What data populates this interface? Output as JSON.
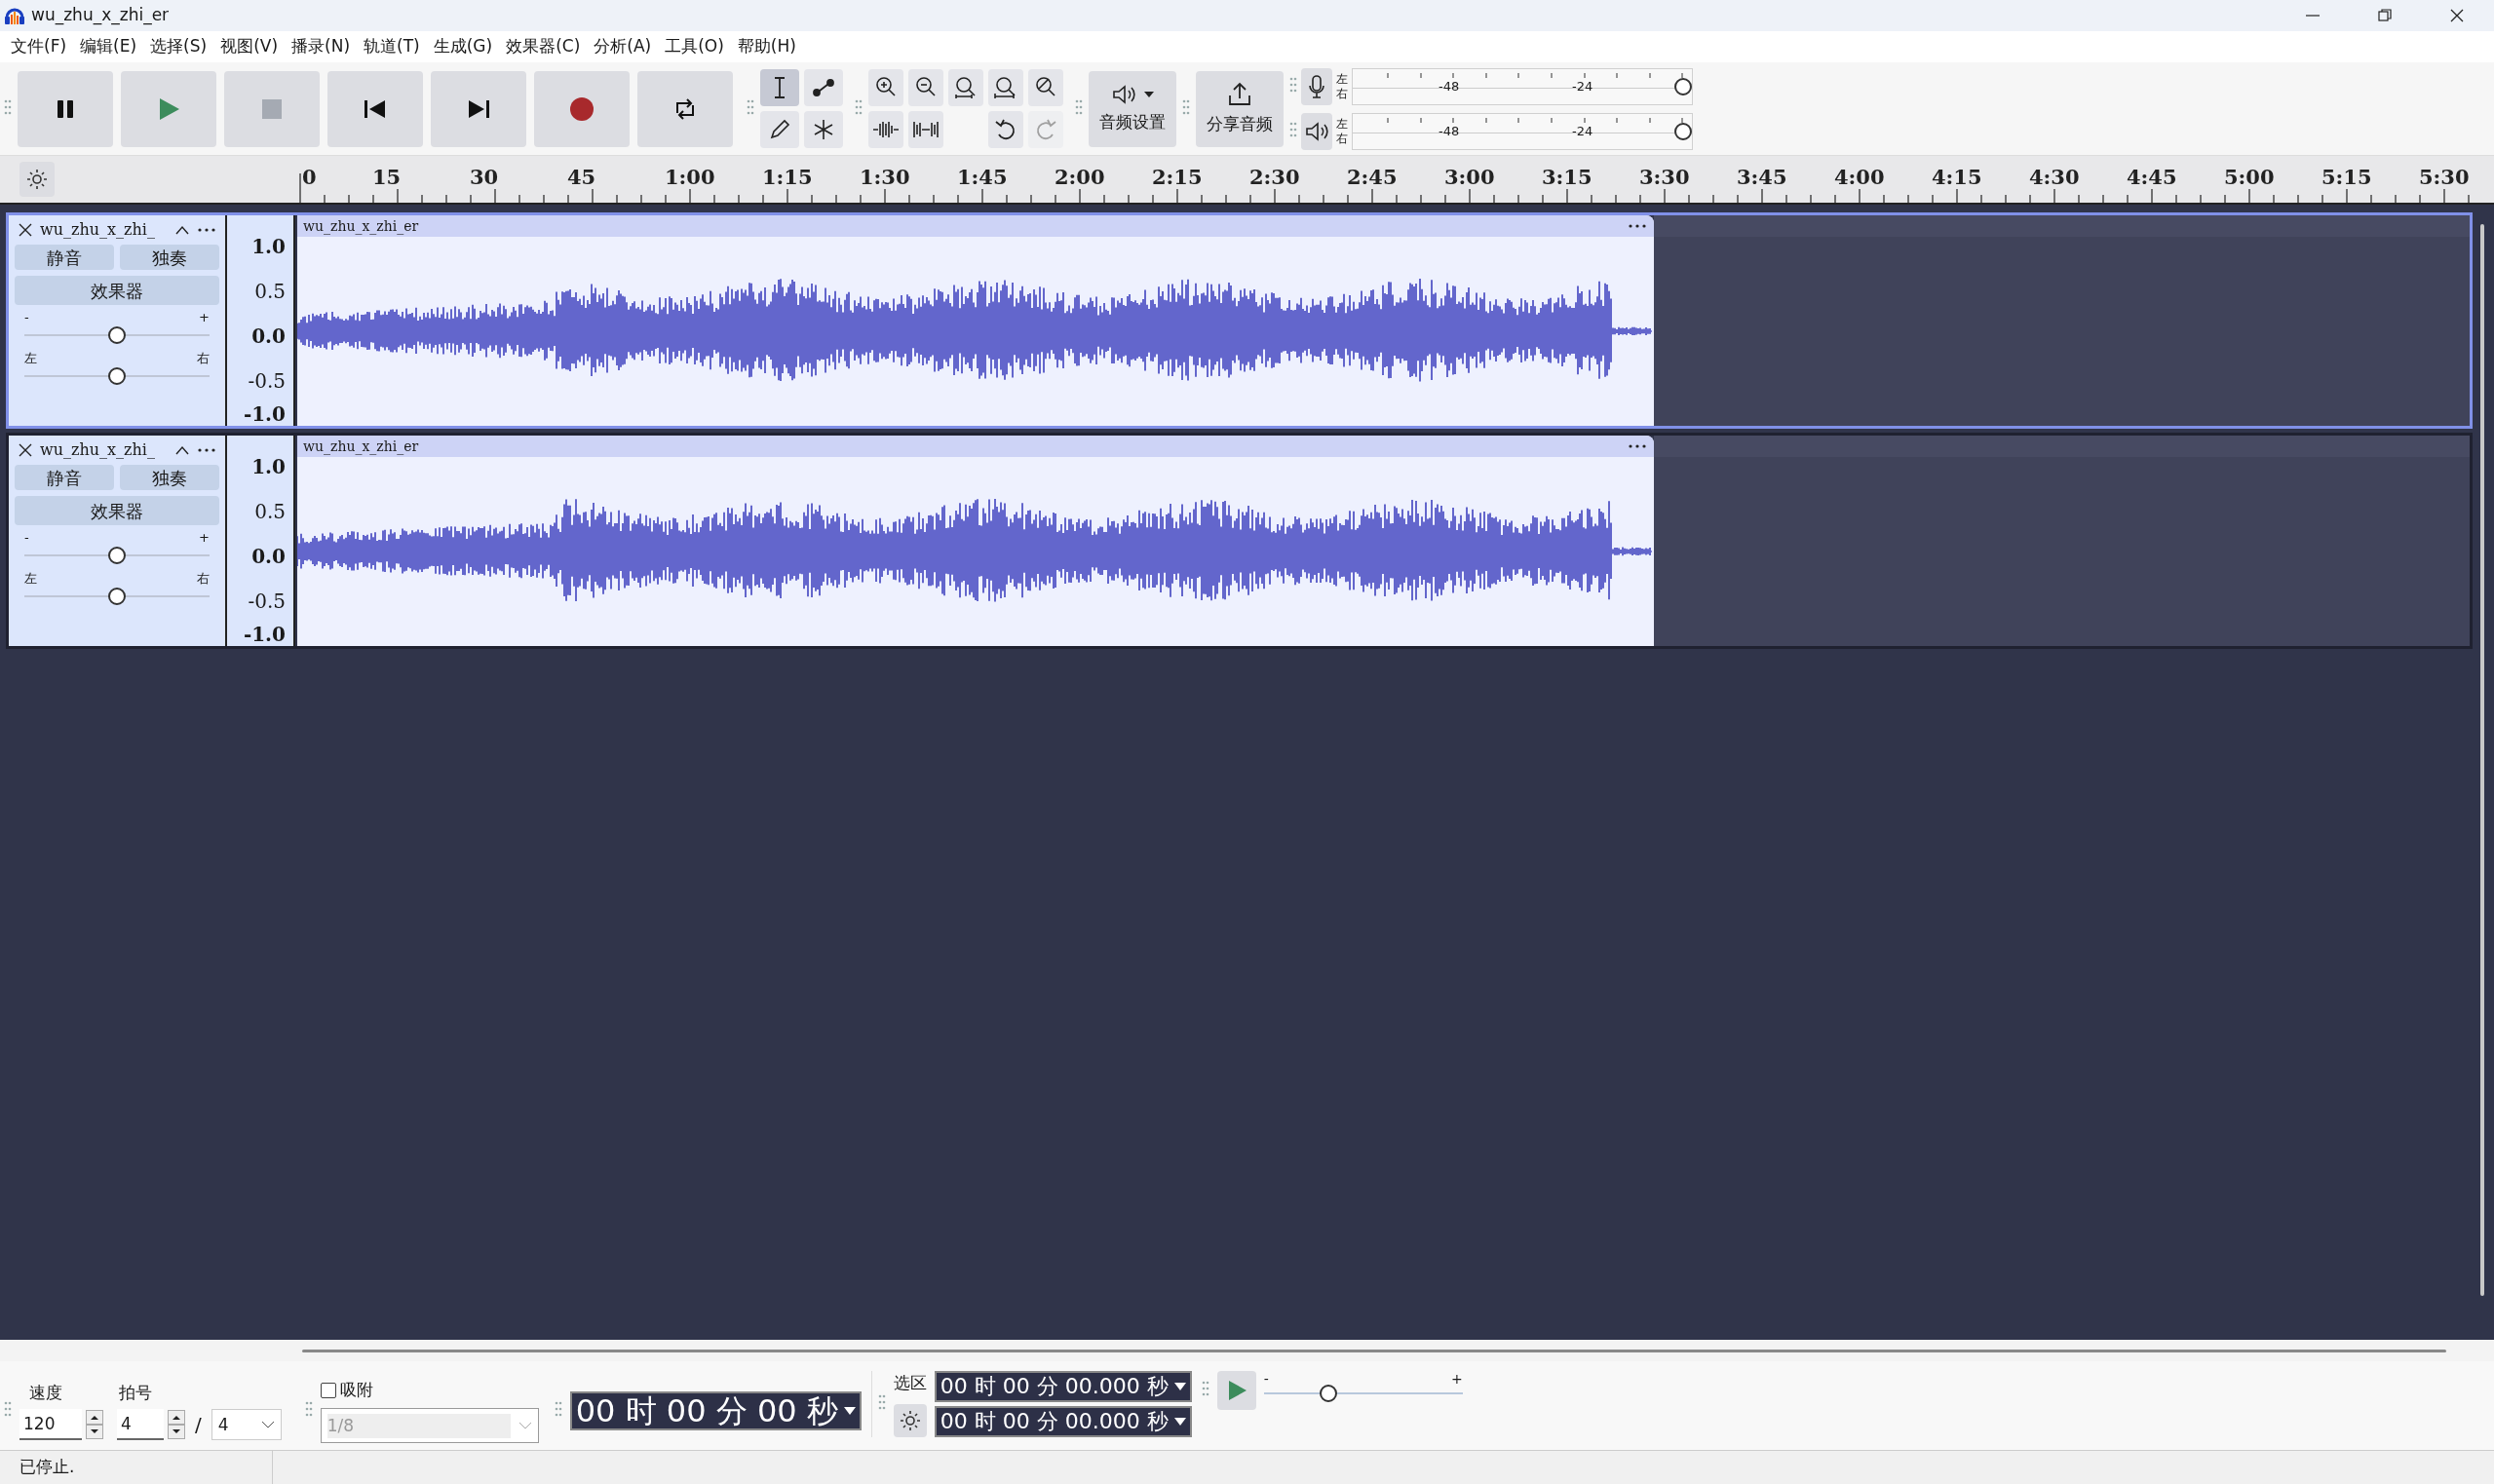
{
  "window": {
    "title": "wu_zhu_x_zhi_er"
  },
  "menu": [
    "文件(F)",
    "编辑(E)",
    "选择(S)",
    "视图(V)",
    "播录(N)",
    "轨道(T)",
    "生成(G)",
    "效果器(C)",
    "分析(A)",
    "工具(O)",
    "帮助(H)"
  ],
  "tools": [
    {
      "kind": "select",
      "selected": true
    },
    {
      "kind": "envelope",
      "selected": false
    },
    {
      "kind": "draw",
      "selected": false
    },
    {
      "kind": "multi",
      "selected": false
    }
  ],
  "edit_buttons": [
    {
      "kind": "zoom-in",
      "disabled": false
    },
    {
      "kind": "zoom-out",
      "disabled": false
    },
    {
      "kind": "fit-selection",
      "disabled": false
    },
    {
      "kind": "fit-project",
      "disabled": false
    },
    {
      "kind": "zoom-toggle",
      "disabled": false
    },
    {
      "kind": "trim",
      "disabled": false
    },
    {
      "kind": "silence",
      "disabled": false
    },
    {
      "kind": "undo",
      "disabled": false
    },
    {
      "kind": "redo",
      "disabled": true
    }
  ],
  "audio_setup": {
    "label": "音频设置"
  },
  "share_audio": {
    "label": "分享音频"
  },
  "meters": [
    {
      "kind": "record",
      "left": "左",
      "right": "右",
      "ticks": [
        "-48",
        "-24"
      ],
      "level": 1.0
    },
    {
      "kind": "play",
      "left": "左",
      "right": "右",
      "ticks": [
        "-48",
        "-24"
      ],
      "level": 1.0
    }
  ],
  "ruler": [
    "0",
    "15",
    "30",
    "45",
    "1:00",
    "1:15",
    "1:30",
    "1:45",
    "2:00",
    "2:15",
    "2:30",
    "2:45",
    "3:00",
    "3:15",
    "3:30",
    "3:45",
    "4:00",
    "4:15",
    "4:30",
    "4:45",
    "5:00",
    "5:15",
    "5:30"
  ],
  "tracks": [
    {
      "name": "wu_zhu_x_zhi_",
      "selected": true,
      "mute": "静音",
      "solo": "独奏",
      "effects": "效果器",
      "gain": {
        "minus": "-",
        "plus": "+",
        "level": 0.5
      },
      "pan": {
        "left": "左",
        "right": "右",
        "level": 0.5
      },
      "scale": [
        "1.0",
        "0.5",
        "0.0",
        "-0.5",
        "-1.0"
      ],
      "clip": {
        "name": "wu_zhu_x_zhi_er"
      }
    },
    {
      "name": "wu_zhu_x_zhi_",
      "selected": false,
      "mute": "静音",
      "solo": "独奏",
      "effects": "效果器",
      "gain": {
        "minus": "-",
        "plus": "+",
        "level": 0.5
      },
      "pan": {
        "left": "左",
        "right": "右",
        "level": 0.5
      },
      "scale": [
        "1.0",
        "0.5",
        "0.0",
        "-0.5",
        "-1.0"
      ],
      "clip": {
        "name": "wu_zhu_x_zhi_er"
      }
    }
  ],
  "bottom": {
    "tempo_label": "速度",
    "tempo": "120",
    "timesig_label": "拍号",
    "beats": "4",
    "slash": "/",
    "unit": "4",
    "snap": {
      "label": "吸附",
      "checked": false,
      "value": "1/8"
    },
    "time": "00 时 00 分 00 秒",
    "selection_label": "选区",
    "selection": [
      "00 时 00 分 00.000 秒",
      "00 时 00 分 00.000 秒"
    ],
    "speed": {
      "minus": "-",
      "plus": "+",
      "level": 0.31
    }
  },
  "status_bar": "已停止."
}
